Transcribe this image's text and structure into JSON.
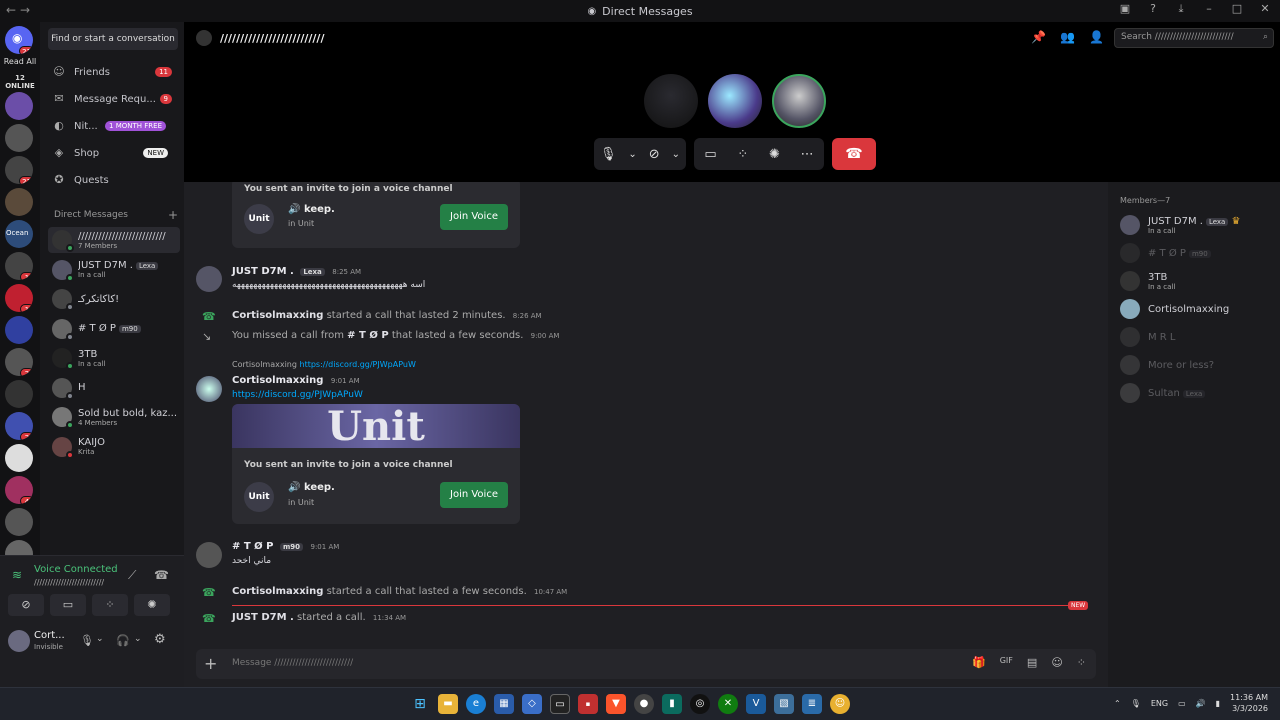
{
  "window": {
    "title": "Direct Messages"
  },
  "guilds": {
    "top_badge": "21",
    "read_all": "Read All",
    "online": "12 ONLINE",
    "items": [
      {
        "color": "#6b4ea8",
        "badge": ""
      },
      {
        "color": "#555",
        "badge": ""
      },
      {
        "color": "#444",
        "badge": "21"
      },
      {
        "color": "#5a4a3a",
        "badge": ""
      },
      {
        "color": "#2d4c7a",
        "badge": "Ocean"
      },
      {
        "color": "#444",
        "badge": "1"
      },
      {
        "color": "#c02030",
        "badge": "1"
      },
      {
        "color": "#3040a0",
        "badge": ""
      },
      {
        "color": "#555",
        "badge": "2"
      },
      {
        "color": "#333",
        "badge": ""
      },
      {
        "color": "#4050b0",
        "badge": "2"
      },
      {
        "color": "#ddd",
        "badge": ""
      },
      {
        "color": "#a03060",
        "badge": "4"
      },
      {
        "color": "#555",
        "badge": ""
      },
      {
        "color": "#666",
        "badge": "41"
      }
    ]
  },
  "sidebar": {
    "find": "Find or start a conversation",
    "nav": [
      {
        "label": "Friends",
        "badge": "11",
        "icon": "friends-icon"
      },
      {
        "label": "Message Requ...",
        "badge": "9",
        "icon": "envelope-icon"
      },
      {
        "label": "Nit...",
        "badge": "1 MONTH FREE",
        "icon": "nitro-icon"
      },
      {
        "label": "Shop",
        "badge": "NEW",
        "icon": "shop-icon"
      },
      {
        "label": "Quests",
        "badge": "",
        "icon": "quests-icon"
      }
    ],
    "dm_header": "Direct Messages",
    "dms": [
      {
        "name": "//////////////////////////",
        "sub": "7 Members",
        "tag": ""
      },
      {
        "name": "JUST D7M .",
        "sub": "In a call",
        "tag": "Lexa"
      },
      {
        "name": "كاكاتكركـ!",
        "sub": "",
        "tag": ""
      },
      {
        "name": "# T Ø P",
        "sub": "",
        "tag": "m90"
      },
      {
        "name": "3TB",
        "sub": "In a call",
        "tag": ""
      },
      {
        "name": "H",
        "sub": "",
        "tag": ""
      },
      {
        "name": "Sold but bold, kaz...",
        "sub": "4 Members",
        "tag": ""
      },
      {
        "name": "KAIJO",
        "sub": "Krita",
        "tag": ""
      }
    ]
  },
  "voice": {
    "status": "Voice Connected",
    "channel": "//////////////////////////"
  },
  "user": {
    "name": "Cort...",
    "status": "Invisible"
  },
  "channel": {
    "name": "//////////////////////////",
    "search_placeholder": "Search //////////////////////////"
  },
  "members": {
    "header": "Members—7",
    "list": [
      {
        "name": "JUST D7M .",
        "sub": "In a call",
        "tag": "Lexa",
        "dim": false
      },
      {
        "name": "# T Ø P",
        "sub": "",
        "tag": "m90",
        "dim": true
      },
      {
        "name": "3TB",
        "sub": "In a call",
        "tag": "",
        "dim": false
      },
      {
        "name": "Cortisolmaxxing",
        "sub": "",
        "tag": "",
        "dim": false
      },
      {
        "name": "M R L",
        "sub": "",
        "tag": "",
        "dim": true
      },
      {
        "name": "More or less?",
        "sub": "",
        "tag": "",
        "dim": true
      },
      {
        "name": "Sultan",
        "sub": "",
        "tag": "Lexa",
        "dim": true
      }
    ]
  },
  "messages": {
    "invite1": {
      "title": "You sent an invite to join a voice channel",
      "name": "keep.",
      "server": "in Unit",
      "join": "Join Voice",
      "logo": "Unit"
    },
    "m1": {
      "author": "JUST D7M .",
      "tag": "Lexa",
      "time": "8:25 AM",
      "text": "اسه هههههههههههههههههههههههههههههههههههههههههه"
    },
    "s1": {
      "who": "Cortisolmaxxing",
      "text": "started a call that lasted 2 minutes.",
      "time": "8:26 AM"
    },
    "s2": {
      "pre": "You missed a call from",
      "who": "# T Ø P",
      "text": "that lasted a few seconds.",
      "time": "9:00 AM"
    },
    "reply": {
      "who": "Cortisolmaxxing",
      "link": "https://discord.gg/PJWpAPuW"
    },
    "m2": {
      "author": "Cortisolmaxxing",
      "time": "9:01 AM",
      "link": "https://discord.gg/PJWpAPuW"
    },
    "banner": "Unit",
    "invite2": {
      "title": "You sent an invite to join a voice channel",
      "name": "keep.",
      "server": "in Unit",
      "join": "Join Voice",
      "logo": "Unit"
    },
    "m3": {
      "author": "# T Ø P",
      "tag": "m90",
      "time": "9:01 AM",
      "text": "ماني اخحد"
    },
    "s3": {
      "who": "Cortisolmaxxing",
      "text": "started a call that lasted a few seconds.",
      "time": "10:47 AM"
    },
    "new": "NEW",
    "s4": {
      "who": "JUST D7M .",
      "text": "started a call.",
      "time": "11:34 AM"
    }
  },
  "composer": {
    "placeholder": "Message //////////////////////////"
  },
  "taskbar": {
    "lang": "ENG",
    "time": "11:36 AM",
    "date": "3/3/2026"
  }
}
